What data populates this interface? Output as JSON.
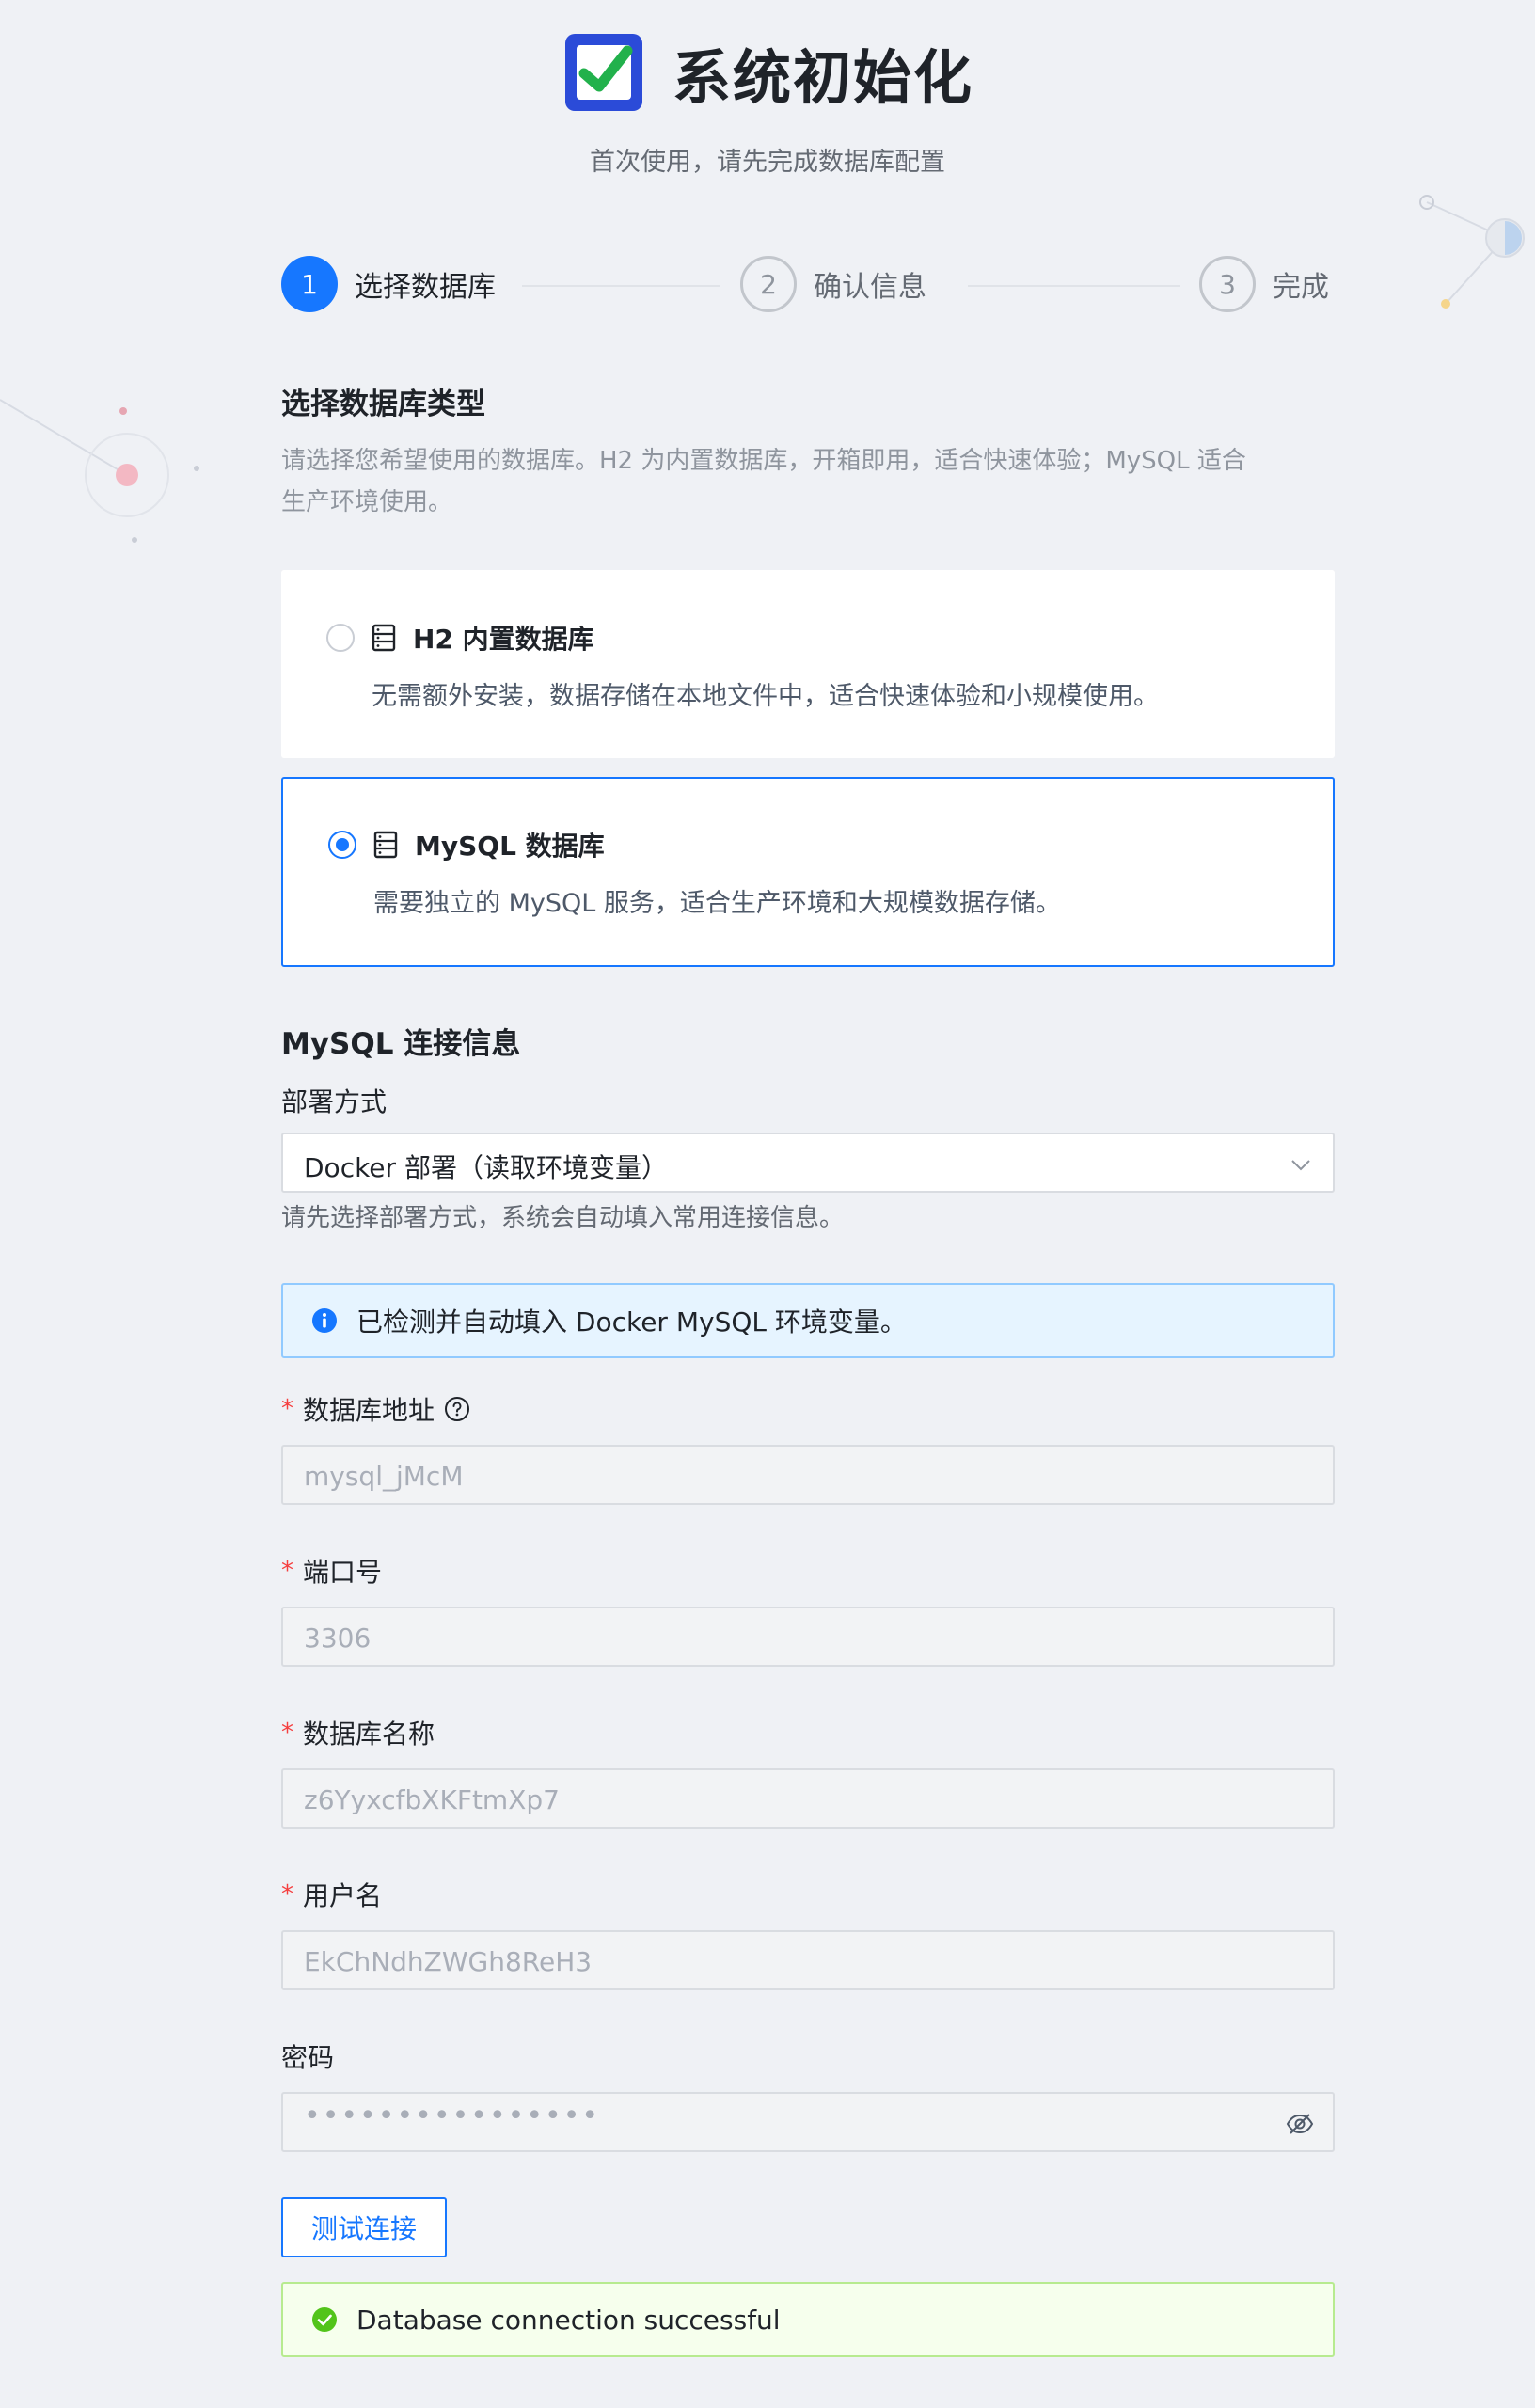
{
  "header": {
    "title": "系统初始化",
    "subtitle": "首次使用，请先完成数据库配置",
    "logo_icon": "checkbox-check-icon"
  },
  "steps": [
    {
      "number": "1",
      "label": "选择数据库",
      "state": "active"
    },
    {
      "number": "2",
      "label": "确认信息",
      "state": "idle"
    },
    {
      "number": "3",
      "label": "完成",
      "state": "idle"
    }
  ],
  "database_section": {
    "title": "选择数据库类型",
    "description_line1": "请选择您希望使用的数据库。H2 为内置数据库，开箱即用，适合快速体验；MySQL 适合",
    "description_line2": "生产环境使用。",
    "options": [
      {
        "name": "H2 内置数据库",
        "description": "无需额外安装，数据存储在本地文件中，适合快速体验和小规模使用。",
        "selected": false
      },
      {
        "name": "MySQL 数据库",
        "description": "需要独立的 MySQL 服务，适合生产环境和大规模数据存储。",
        "selected": true
      }
    ]
  },
  "mysql_section": {
    "title": "MySQL 连接信息",
    "deploy_label": "部署方式",
    "deploy_value": "Docker 部署（读取环境变量）",
    "deploy_hint": "请先选择部署方式，系统会自动填入常用连接信息。",
    "info_alert": "已检测并自动填入 Docker MySQL 环境变量。",
    "fields": {
      "host": {
        "label": "数据库地址",
        "value": "mysql_jMcM",
        "required": true
      },
      "port": {
        "label": "端口号",
        "value": "3306",
        "required": true
      },
      "dbname": {
        "label": "数据库名称",
        "value": "z6YyxcfbXKFtmXp7",
        "required": true
      },
      "username": {
        "label": "用户名",
        "value": "EkChNdhZWGh8ReH3",
        "required": true
      },
      "password": {
        "label": "密码",
        "value": "••••••••••••••••",
        "required": false
      }
    },
    "required_mark": "*",
    "test_button": "测试连接",
    "success_alert": "Database connection successful"
  },
  "colors": {
    "primary": "#1677ff",
    "success": "#52c41a",
    "required": "#f53f3f",
    "background": "#eff1f5"
  }
}
